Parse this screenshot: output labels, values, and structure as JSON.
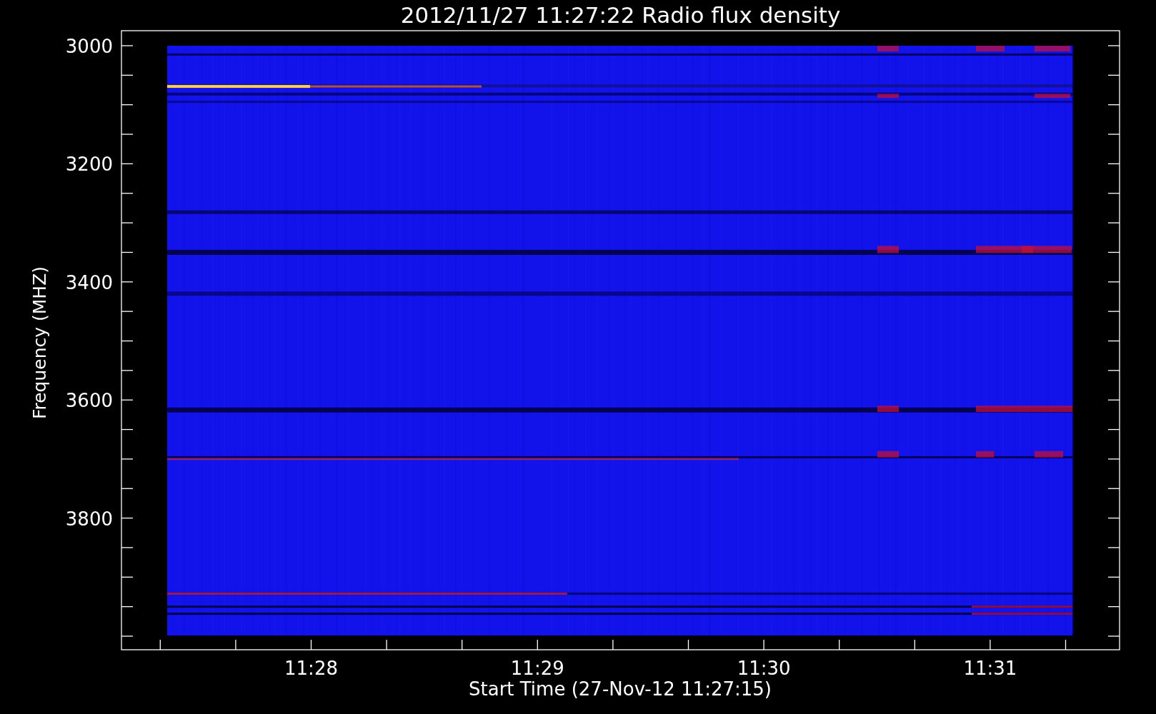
{
  "title": "2012/11/27 11:27:22 Radio flux density",
  "y_axis": {
    "label": "Frequency (MHZ)",
    "ticks": [
      "3000",
      "3200",
      "3400",
      "3600",
      "3800"
    ]
  },
  "x_axis": {
    "label": "Start Time (27-Nov-12 11:27:15)",
    "ticks": [
      "11:28",
      "11:29",
      "11:30",
      "11:31"
    ]
  }
}
